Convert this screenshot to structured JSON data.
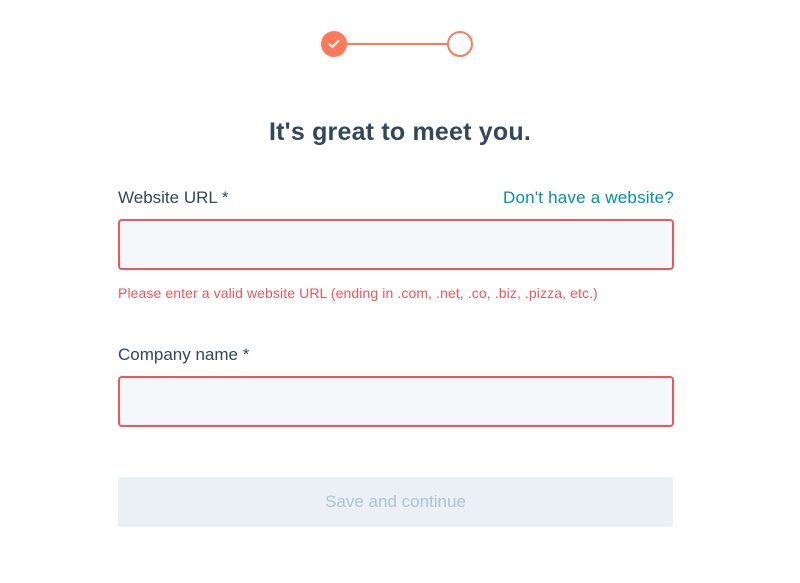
{
  "stepper": {
    "total_steps": 2,
    "completed_steps": 1,
    "accent_color": "#ff7a59"
  },
  "heading": "It's great to meet you.",
  "website_field": {
    "label": "Website URL *",
    "help_link": "Don't have a website?",
    "value": "",
    "error": "Please enter a valid website URL (ending in .com, .net, .co, .biz, .pizza, etc.)"
  },
  "company_field": {
    "label": "Company name *",
    "value": ""
  },
  "submit": {
    "label": "Save and continue",
    "disabled": true
  },
  "colors": {
    "error": "#f2545b",
    "link": "#0091ae",
    "text": "#33475b",
    "input_bg": "#f5f8fa",
    "button_disabled_bg": "#eaf0f6",
    "button_disabled_text": "#b0c1d4"
  }
}
